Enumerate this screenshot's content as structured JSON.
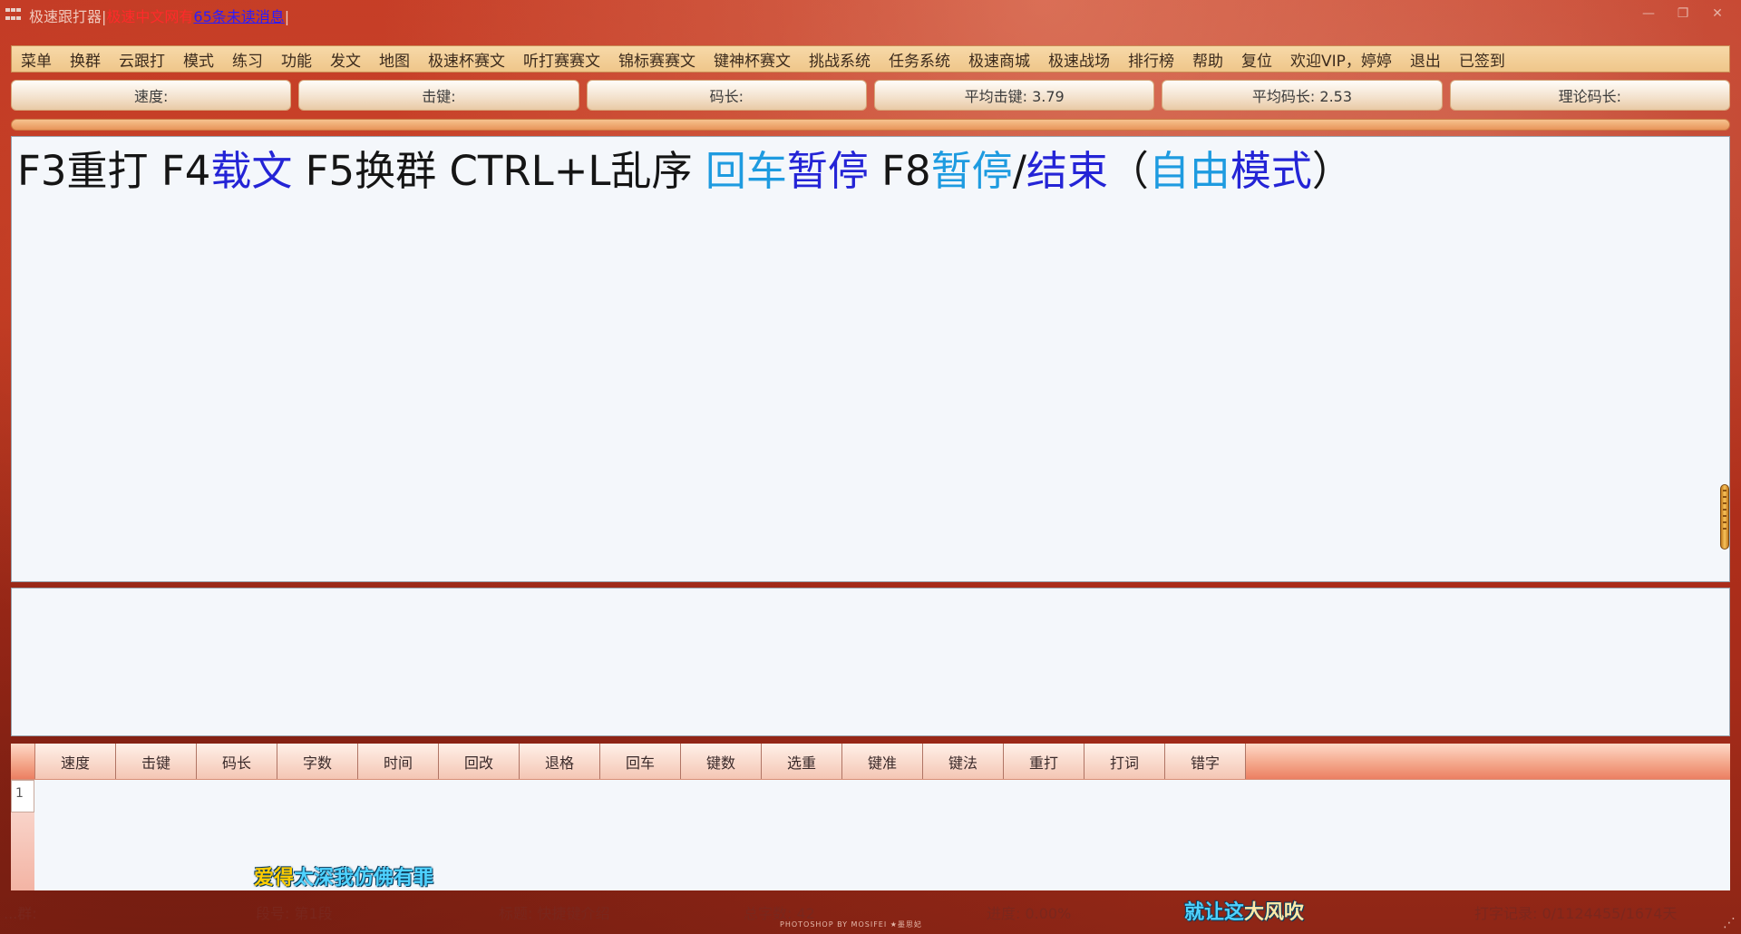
{
  "titlebar": {
    "app_name": "极速跟打器",
    "sep": "|",
    "highlight": "极速中文网有",
    "messages_link": "65条未读消息"
  },
  "menu": [
    "菜单",
    "换群",
    "云跟打",
    "模式",
    "练习",
    "功能",
    "发文",
    "地图",
    "极速杯赛文",
    "听打赛赛文",
    "锦标赛赛文",
    "键神杯赛文",
    "挑战系统",
    "任务系统",
    "极速商城",
    "极速战场",
    "排行榜",
    "帮助",
    "复位",
    "欢迎VIP，婷婷",
    "退出",
    "已签到"
  ],
  "stats": {
    "speed": "速度:",
    "keystroke": "击键:",
    "code_length": "码长:",
    "avg_keystroke": "平均击键: 3.79",
    "avg_code_length": "平均码长: 2.53",
    "theory_code_length": "理论码长:"
  },
  "text_segments": [
    {
      "text": "F3重打 F4",
      "color": "black"
    },
    {
      "text": "载文",
      "color": "blue"
    },
    {
      "text": " F5换群 CTRL+L乱序 ",
      "color": "black"
    },
    {
      "text": "回车",
      "color": "cyan"
    },
    {
      "text": "暂停",
      "color": "blue"
    },
    {
      "text": " F8",
      "color": "black"
    },
    {
      "text": "暂停",
      "color": "cyan"
    },
    {
      "text": "/",
      "color": "black"
    },
    {
      "text": "结束",
      "color": "blue"
    },
    {
      "text": "（",
      "color": "black"
    },
    {
      "text": "自由",
      "color": "cyan"
    },
    {
      "text": "模式",
      "color": "blue"
    },
    {
      "text": "）",
      "color": "black"
    }
  ],
  "table": {
    "headers": [
      "速度",
      "击键",
      "码长",
      "字数",
      "时间",
      "回改",
      "退格",
      "回车",
      "键数",
      "选重",
      "键准",
      "键法",
      "重打",
      "打词",
      "错字"
    ],
    "row_numbers": [
      "1"
    ]
  },
  "lyrics": {
    "line1": [
      {
        "text": "爱得",
        "color": "yellow"
      },
      {
        "text": "太",
        "color": "blue"
      },
      {
        "text": "深我仿佛有罪",
        "color": "blue2"
      }
    ],
    "line2": [
      {
        "text": "就让这",
        "color": "blue"
      },
      {
        "text": "大风吹",
        "color": "white"
      }
    ]
  },
  "statusbar": {
    "group": "...群:",
    "segment": "段号: 第1段",
    "title": "标题: 快捷键介绍",
    "total_chars": "总字数: 42",
    "progress": "进度: 0.00%",
    "record": "打字记录: 0/1124455/1674天"
  },
  "photo_credit": "PHOTOSHOP BY MOSIFEI ★墨思妃",
  "colors": {
    "black": "#151515",
    "blue": "#2424d6",
    "cyan": "#1e9be0",
    "menu_bg": "#f7d9a8"
  }
}
